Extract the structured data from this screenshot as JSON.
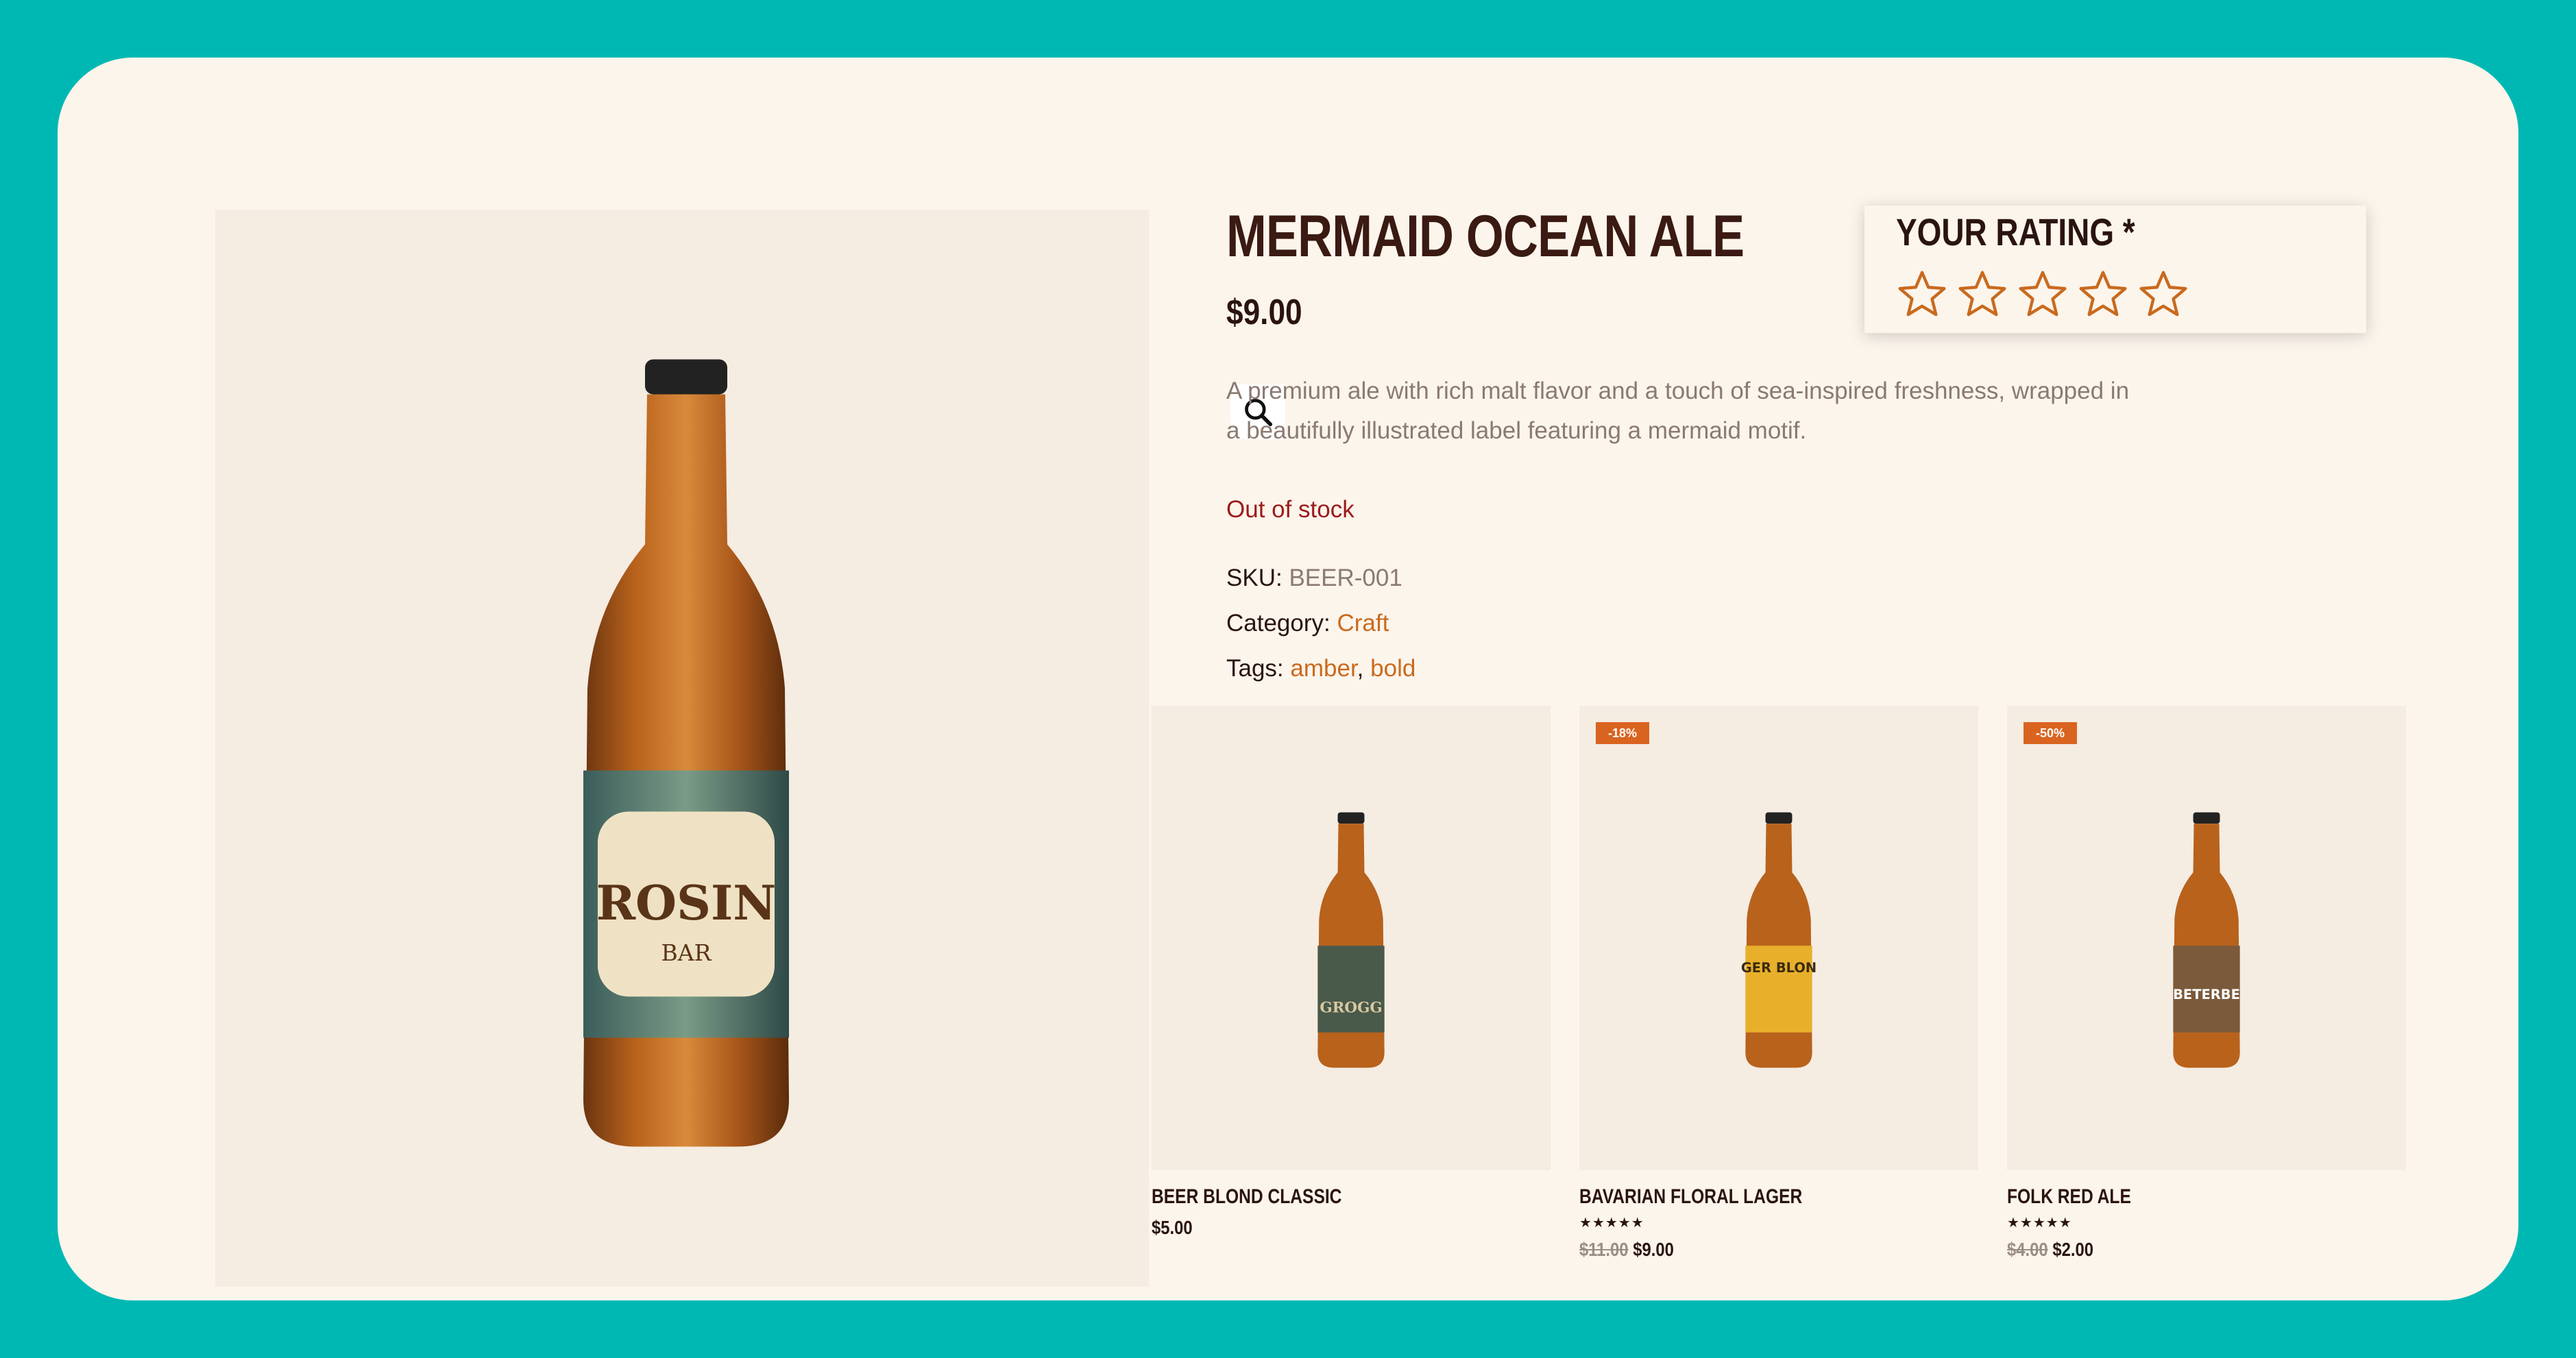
{
  "product": {
    "title": "MERMAID OCEAN ALE",
    "price": "$9.00",
    "description": "A premium ale with rich malt flavor and a touch of sea-inspired freshness, wrapped in a beautifully illustrated label featuring a mermaid motif.",
    "stock_status": "Out of stock",
    "sku_label": "SKU:",
    "sku": "BEER-001",
    "category_label": "Category:",
    "category": "Craft",
    "tags_label": "Tags:",
    "tags": [
      "amber",
      "bold"
    ],
    "tag_separator": ",",
    "label_text": "ROSIN",
    "label_sub": "BAR"
  },
  "rating": {
    "label": "YOUR RATING *",
    "stars_selected": 0,
    "stars_total": 5
  },
  "related": [
    {
      "name": "BEER BLOND CLASSIC",
      "price": "$5.00",
      "old_price": "",
      "badge": "",
      "rating": 0,
      "label_text": "GROGG",
      "label_color": "#4a5a4a"
    },
    {
      "name": "BAVARIAN FLORAL LAGER",
      "price": "$9.00",
      "old_price": "$11.00",
      "badge": "-18%",
      "rating": 5,
      "label_text": "GER BLON",
      "label_color": "#e8b02a"
    },
    {
      "name": "FOLK RED ALE",
      "price": "$2.00",
      "old_price": "$4.00",
      "badge": "-50%",
      "rating": 5,
      "label_text": "BETERBE",
      "label_color": "#7a5a3a"
    }
  ],
  "icons": {
    "zoom": "magnifier-icon",
    "star_empty": "star-outline-icon",
    "star_full": "star-filled-icon"
  },
  "colors": {
    "background": "#00b8b3",
    "card": "#fcf5ec",
    "accent": "#c96a1e",
    "stock": "#9b1b1b",
    "badge": "#d9641f"
  }
}
